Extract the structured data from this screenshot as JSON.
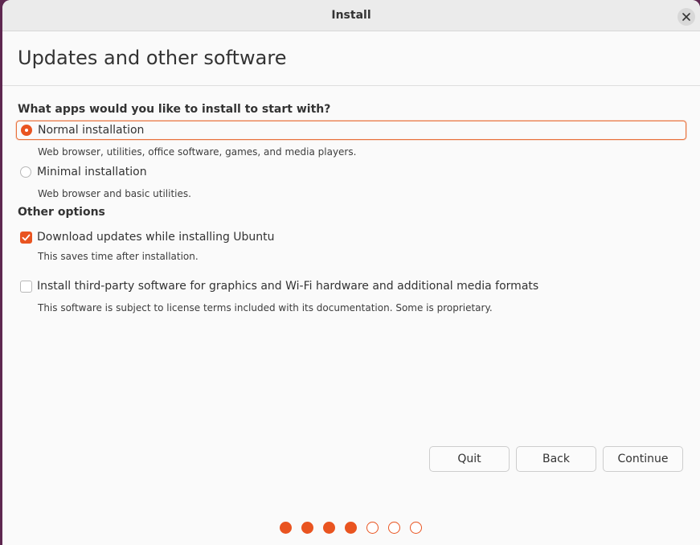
{
  "window": {
    "title": "Install"
  },
  "page": {
    "title": "Updates and other software"
  },
  "install_section": {
    "heading": "What apps would you like to install to start with?",
    "options": [
      {
        "label": "Normal installation",
        "description": "Web browser, utilities, office software, games, and media players.",
        "selected": true
      },
      {
        "label": "Minimal installation",
        "description": "Web browser and basic utilities.",
        "selected": false
      }
    ]
  },
  "other_options": {
    "heading": "Other options",
    "items": [
      {
        "label": "Download updates while installing Ubuntu",
        "description": "This saves time after installation.",
        "checked": true
      },
      {
        "label": "Install third-party software for graphics and Wi-Fi hardware and additional media formats",
        "description": "This software is subject to license terms included with its documentation. Some is proprietary.",
        "checked": false
      }
    ]
  },
  "buttons": {
    "quit": "Quit",
    "back": "Back",
    "continue": "Continue"
  },
  "progress": {
    "total_steps": 7,
    "completed_steps": 4
  },
  "colors": {
    "accent": "#e95420",
    "desktop": "#5e2750"
  },
  "icons": {
    "close": "close-icon",
    "checkmark": "checkmark-icon"
  }
}
